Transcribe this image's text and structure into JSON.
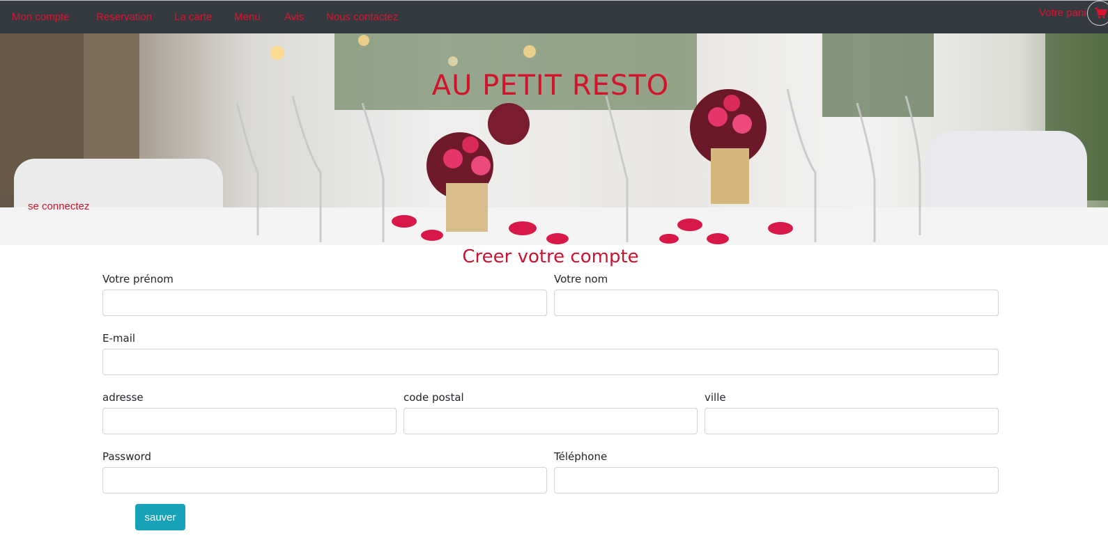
{
  "nav": {
    "items": [
      {
        "label": "Mon compte"
      },
      {
        "label": "Reservation"
      },
      {
        "label": "La carte"
      },
      {
        "label": "Menu"
      },
      {
        "label": "Avis"
      },
      {
        "label": "Nous contactez"
      }
    ],
    "cart_label": "Votre panier",
    "cart_icon": "shopping-cart-icon"
  },
  "hero": {
    "title": "AU PETIT RESTO",
    "login_link": "se connectez"
  },
  "form": {
    "title": "Creer votre compte",
    "firstname_label": "Votre prénom",
    "firstname_value": "",
    "lastname_label": "Votre nom",
    "lastname_value": "",
    "email_label": "E-mail",
    "email_value": "",
    "address_label": "adresse",
    "address_value": "",
    "postal_label": "code postal",
    "postal_value": "",
    "city_label": "ville",
    "city_value": "",
    "password_label": "Password",
    "password_value": "",
    "phone_label": "Téléphone",
    "phone_value": "",
    "save_label": "sauver"
  },
  "colors": {
    "navbar": "#343a40",
    "accent_red": "#dc1430",
    "button": "#17a2b8"
  }
}
